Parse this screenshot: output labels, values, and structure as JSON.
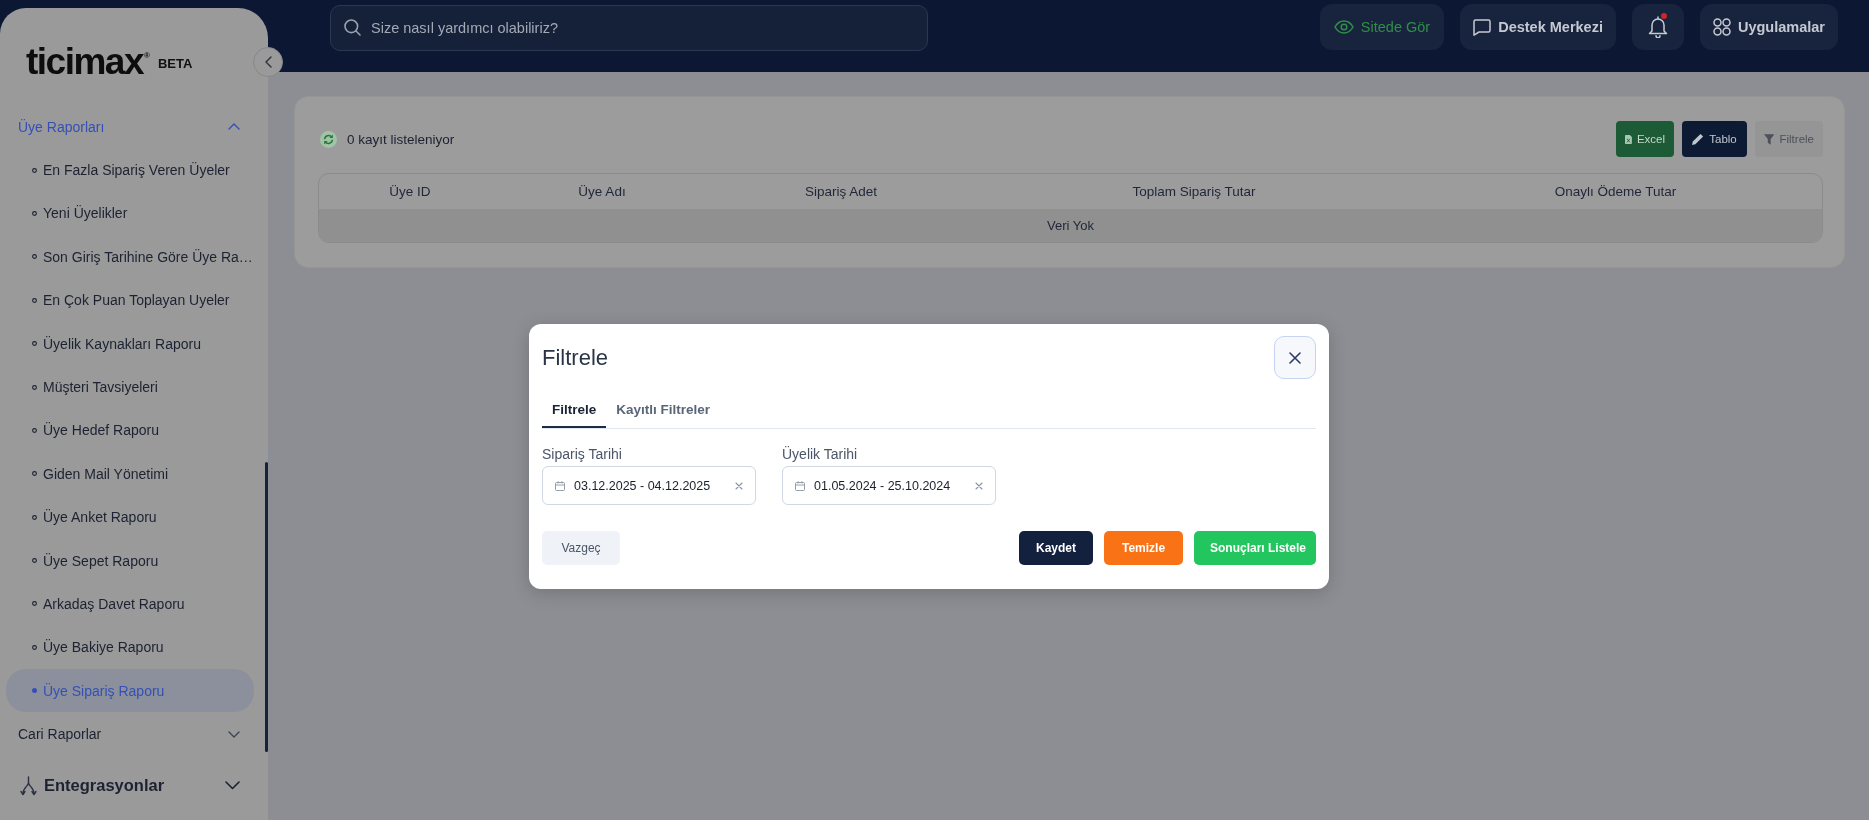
{
  "sidebar": {
    "logo": "ticimax$^{®}$",
    "badge": "BETA",
    "menu": [
      {
        "kind": "group",
        "label": "Üye Raporları",
        "expanded": true,
        "children": [
          {
            "label": "En Fazla Sipariş Veren Üyeler",
            "selected": false
          },
          {
            "label": "Yeni Üyelikler",
            "selected": false
          },
          {
            "label": "Son Giriş Tarihine Göre Üye Ra…",
            "selected": false
          },
          {
            "label": "En Çok Puan Toplayan Uyeler",
            "selected": false
          },
          {
            "label": "Üyelik Kaynakları Raporu",
            "selected": false
          },
          {
            "label": "Müşteri Tavsiyeleri",
            "selected": false
          },
          {
            "label": "Üye Hedef Raporu",
            "selected": false
          },
          {
            "label": "Giden Mail Yönetimi",
            "selected": false
          },
          {
            "label": "Üye Anket Raporu",
            "selected": false
          },
          {
            "label": "Üye Sepet Raporu",
            "selected": false
          },
          {
            "label": "Arkadaş Davet Raporu",
            "selected": false
          },
          {
            "label": "Üye Bakiye Raporu",
            "selected": false
          },
          {
            "label": "Üye Sipariş Raporu",
            "selected": true
          }
        ]
      },
      {
        "kind": "group",
        "label": "Cari Raporlar",
        "expanded": false
      },
      {
        "kind": "section",
        "label": "Entegrasyonlar",
        "expanded": false
      }
    ]
  },
  "topbar": {
    "search": {
      "placeholder": "Size nasıl yardımcı olabiliriz?"
    },
    "actions": [
      {
        "kind": "view",
        "label": "Sitede Gör"
      },
      {
        "kind": "support",
        "label": "Destek Merkezi"
      },
      {
        "kind": "notifications",
        "unread": true
      },
      {
        "kind": "apps",
        "label": "Uygulamalar"
      }
    ]
  },
  "report": {
    "count_text": "0 kayıt listeleniyor",
    "toolbar": [
      {
        "kind": "excel",
        "label": "Excel"
      },
      {
        "kind": "table",
        "label": "Tablo"
      },
      {
        "kind": "filter",
        "label": "Filtrele"
      }
    ],
    "table": {
      "columns": [
        "Üye ID",
        "Üye Adı",
        "Sipariş Adet",
        "Toplam Sipariş Tutar",
        "Onaylı Ödeme Tutar"
      ],
      "empty_text": "Veri Yok"
    }
  },
  "modal": {
    "title": "Filtrele",
    "tabs": [
      {
        "label": "Filtrele",
        "selected": true
      },
      {
        "label": "Kayıtlı Filtreler",
        "selected": false
      }
    ],
    "fields": [
      {
        "label": "Sipariş Tarihi",
        "value": "03.12.2025 - 04.12.2025"
      },
      {
        "label": "Üyelik Tarihi",
        "value": "01.05.2024 - 25.10.2024"
      }
    ],
    "buttons": [
      {
        "kind": "cancel",
        "label": "Vazgeç"
      },
      {
        "kind": "save",
        "label": "Kaydet"
      },
      {
        "kind": "clear",
        "label": "Temizle"
      },
      {
        "kind": "submit",
        "label": "Sonuçları Listele"
      }
    ]
  }
}
